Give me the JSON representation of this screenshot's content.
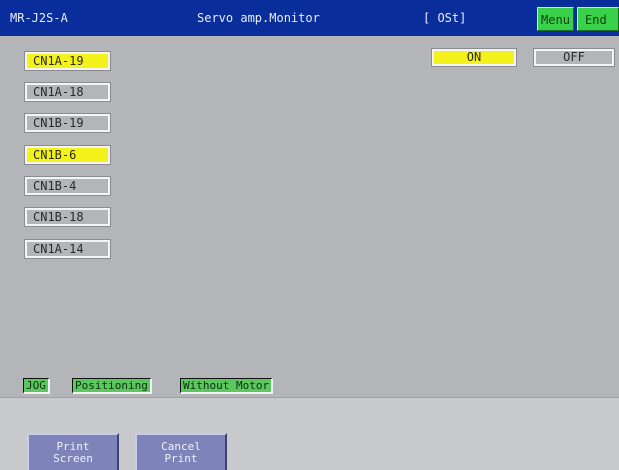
{
  "header": {
    "model": "MR-J2S-A",
    "title": "Servo amp.Monitor",
    "status": "[ OSt]",
    "menu_label": "Menu",
    "end_label": "End",
    "bar_color": "#0a2d9c",
    "button_color": "#39d14a"
  },
  "legend": {
    "on_label": "ON",
    "off_label": "OFF",
    "on_color": "#f3f21a"
  },
  "signals": [
    {
      "label": "CN1A-19",
      "state": "on"
    },
    {
      "label": "CN1A-18",
      "state": "off"
    },
    {
      "label": "CN1B-19",
      "state": "off"
    },
    {
      "label": "CN1B-6",
      "state": "on"
    },
    {
      "label": "CN1B-4",
      "state": "off"
    },
    {
      "label": "CN1B-18",
      "state": "off"
    },
    {
      "label": "CN1A-14",
      "state": "off"
    }
  ],
  "modes": {
    "jog": "JOG",
    "positioning": "Positioning",
    "without_motor": "Without Motor"
  },
  "footer": {
    "print_screen": [
      "Print",
      "Screen"
    ],
    "cancel_print": [
      "Cancel",
      "Print"
    ]
  }
}
